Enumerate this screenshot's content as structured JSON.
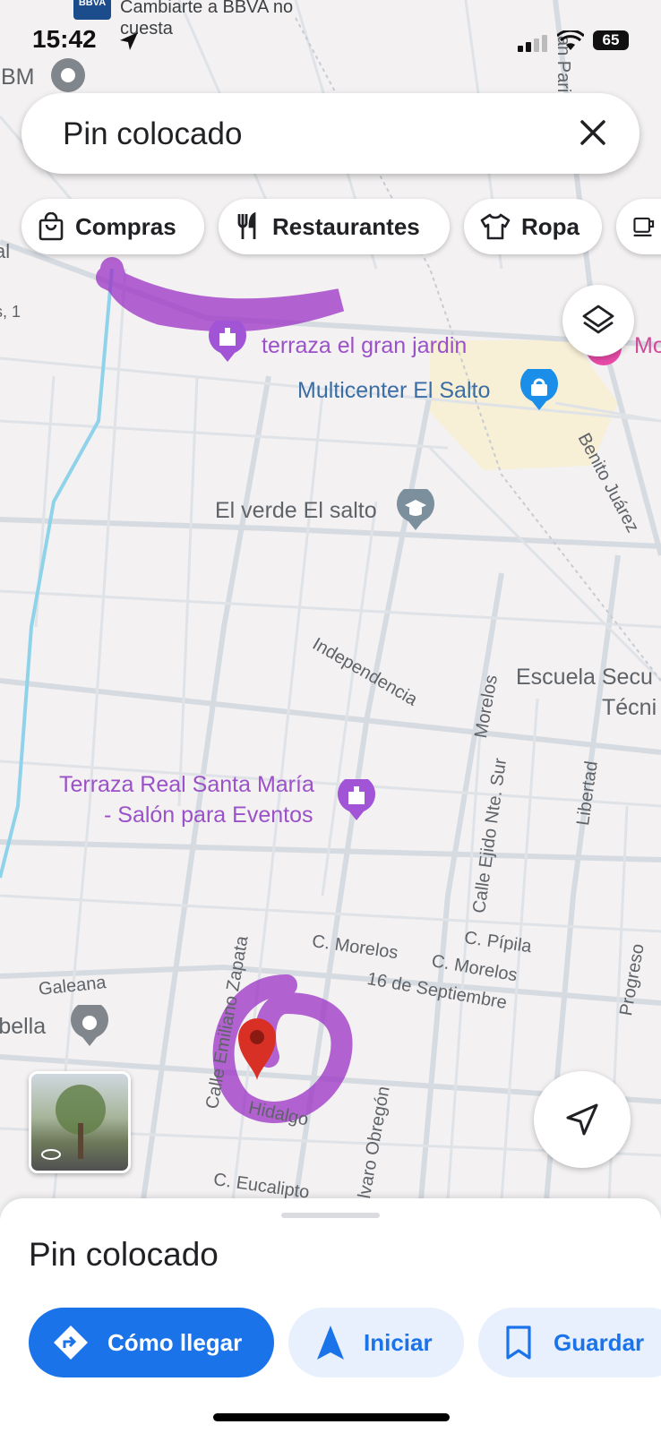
{
  "status": {
    "time": "15:42",
    "battery": "65",
    "notification_text": "Cambiarte a BBVA no cuesta",
    "bank_badge": "BBVA"
  },
  "search": {
    "text": "Pin colocado"
  },
  "chips": [
    {
      "label": "Compras",
      "icon": "shopping-bag-icon"
    },
    {
      "label": "Restaurantes",
      "icon": "fork-knife-icon"
    },
    {
      "label": "Ropa",
      "icon": "shirt-icon"
    },
    {
      "label": "",
      "icon": "coffee-icon"
    }
  ],
  "map": {
    "pois": [
      {
        "name": "terraza el gran jardin",
        "type": "event-venue"
      },
      {
        "name": "Multicenter El Salto",
        "type": "shopping"
      },
      {
        "name": "El verde El salto",
        "type": "school"
      },
      {
        "name": "Terraza Real Santa María - Salón para Eventos",
        "line1": "Terraza Real Santa María",
        "line2": "- Salón para Eventos",
        "type": "event-venue"
      },
      {
        "name": "Escuela Secu",
        "line1": "Escuela Secu",
        "line2": "Técni",
        "type": "school"
      },
      {
        "name": "IBM",
        "type": "place"
      },
      {
        "name": "rbella",
        "type": "place"
      },
      {
        "name": "Mo",
        "type": "shopping"
      }
    ],
    "streets": [
      "Independencia",
      "Morelos",
      "Calle Ejido Nte. Sur",
      "Libertad",
      "C. Pípila",
      "C. Morelos",
      "C. Morelos",
      "16 de Septiembre",
      "Progreso",
      "Galeana",
      "Calle Emiliano Zapata",
      "Hidalgo",
      "lvaro Obregón",
      "C. Eucalipto",
      "Benito Juárez",
      "an Parian",
      "al",
      "s, 1"
    ]
  },
  "sheet": {
    "title": "Pin colocado",
    "actions": {
      "directions": "Cómo llegar",
      "start": "Iniciar",
      "save": "Guardar"
    }
  },
  "colors": {
    "accent": "#1a73e8",
    "pin": "#d93025",
    "annotation": "#9b30c4"
  }
}
